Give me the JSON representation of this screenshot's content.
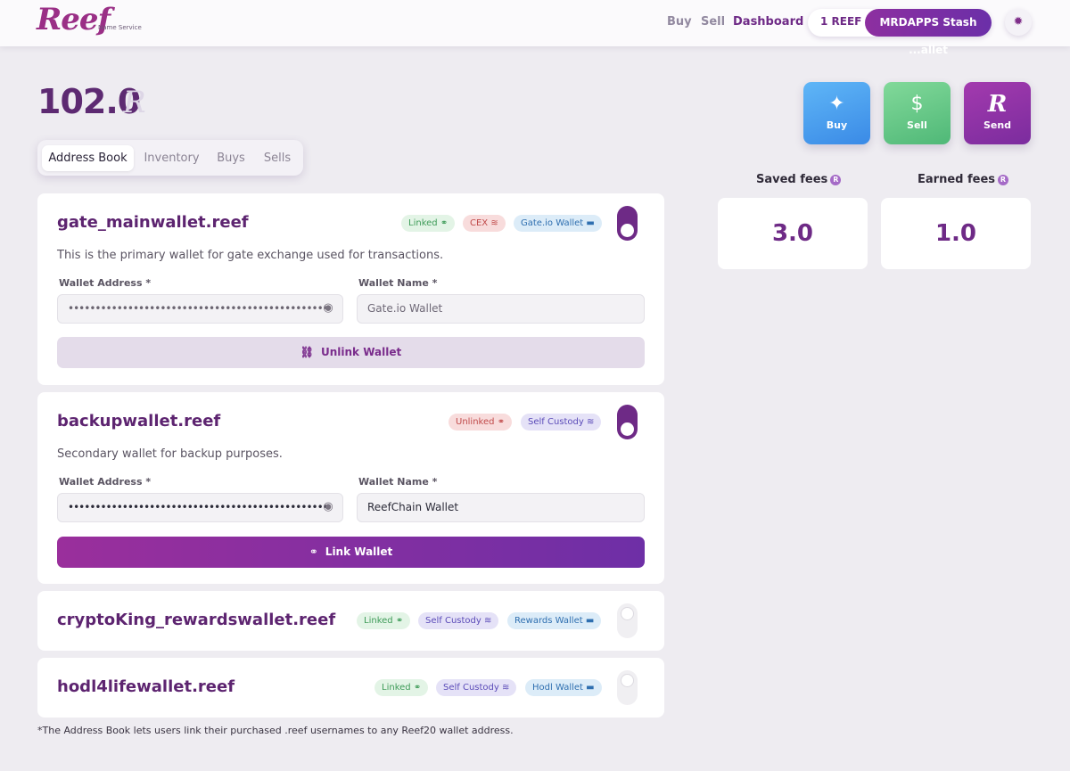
{
  "header": {
    "logo": "Reef",
    "logo_sub": "Name Service",
    "nav": [
      "Buy",
      "Sell",
      "Dashboard"
    ],
    "balance_pill": "1 REEF",
    "account_pill": "MRDAPPS Stash ...allet",
    "settings_icon": "gear-icon"
  },
  "balance": {
    "value": "102.0",
    "symbol": "R"
  },
  "tabs": [
    "Address Book",
    "Inventory",
    "Buys",
    "Sells"
  ],
  "actions": {
    "buy": "Buy",
    "sell": "Sell",
    "send": "Send"
  },
  "fees": {
    "saved_label": "Saved fees",
    "saved_value": "3.0",
    "earned_label": "Earned fees",
    "earned_value": "1.0",
    "help_symbol": "R"
  },
  "wallets": [
    {
      "name": "gate_mainwallet.reef",
      "status": "Linked",
      "type": "CEX",
      "wallet_badge": "Gate.io Wallet",
      "enabled": true,
      "description": "This is the primary wallet for gate exchange used for transactions.",
      "address_label": "Wallet Address *",
      "address": "••••••••••••••••••••••••••••••••••••••••••••••••",
      "name_label": "Wallet Name *",
      "wallet_name": "Gate.io Wallet",
      "wallet_name_is_placeholder": true,
      "action": "Unlink Wallet"
    },
    {
      "name": "backupwallet.reef",
      "status": "Unlinked",
      "type": "Self Custody",
      "enabled": true,
      "description": "Secondary wallet for backup purposes.",
      "address_label": "Wallet Address *",
      "address": "••••••••••••••••••••••••••••••••••••••••••••••••",
      "name_label": "Wallet Name *",
      "wallet_name": "ReefChain Wallet",
      "action": "Link Wallet"
    },
    {
      "name": "cryptoKing_rewardswallet.reef",
      "status": "Linked",
      "type": "Self Custody",
      "wallet_badge": "Rewards Wallet",
      "enabled": false
    },
    {
      "name": "hodl4lifewallet.reef",
      "status": "Linked",
      "type": "Self Custody",
      "wallet_badge": "Hodl Wallet",
      "enabled": false
    }
  ],
  "footnote": "*The Address Book lets users link their purchased .reef usernames to any Reef20 wallet address."
}
